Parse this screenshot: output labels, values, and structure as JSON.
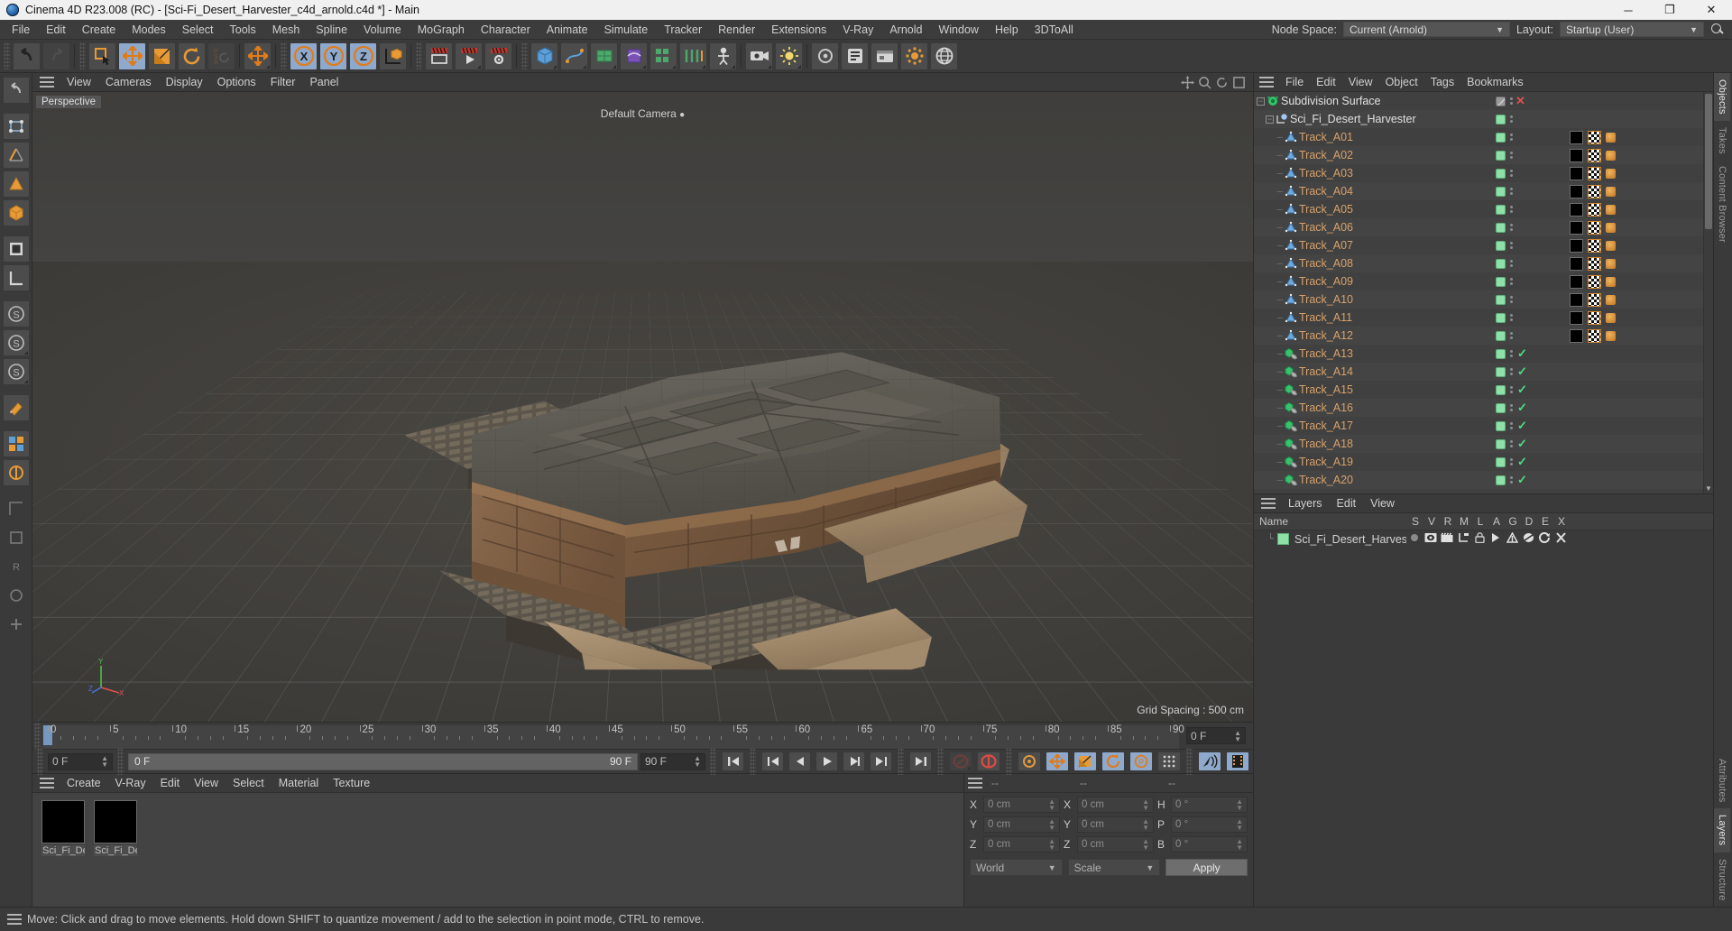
{
  "window": {
    "title": "Cinema 4D R23.008 (RC) - [Sci-Fi_Desert_Harvester_c4d_arnold.c4d *] - Main",
    "minimize": "─",
    "maximize": "❐",
    "close": "✕"
  },
  "menubar": {
    "items": [
      "File",
      "Edit",
      "Create",
      "Modes",
      "Select",
      "Tools",
      "Mesh",
      "Spline",
      "Volume",
      "MoGraph",
      "Character",
      "Animate",
      "Simulate",
      "Tracker",
      "Render",
      "Extensions",
      "V-Ray",
      "Arnold",
      "Window",
      "Help",
      "3DToAll"
    ],
    "node_space_label": "Node Space:",
    "node_space_value": "Current (Arnold)",
    "layout_label": "Layout:",
    "layout_value": "Startup (User)",
    "search_icon": "search-icon"
  },
  "viewport": {
    "menu": [
      "View",
      "Cameras",
      "Display",
      "Options",
      "Filter",
      "Panel"
    ],
    "view_label": "Perspective",
    "camera_label": "Default Camera",
    "grid_spacing": "Grid Spacing : 500 cm",
    "axis_x": "X",
    "axis_y": "Y",
    "axis_z": "Z"
  },
  "timeline": {
    "ticks": [
      0,
      5,
      10,
      15,
      20,
      25,
      30,
      35,
      40,
      45,
      50,
      55,
      60,
      65,
      70,
      75,
      80,
      85,
      90
    ],
    "current_frame": "0 F",
    "range_start": "0 F",
    "range_end": "90 F",
    "end_field": "90 F",
    "right_field": "0 F",
    "playhead_frame": 0
  },
  "material_manager": {
    "menu": [
      "Create",
      "V-Ray",
      "Edit",
      "View",
      "Select",
      "Material",
      "Texture"
    ],
    "materials": [
      {
        "name": "Sci_Fi_De",
        "color": "#000000"
      },
      {
        "name": "Sci_Fi_De",
        "color": "#000000"
      }
    ]
  },
  "coordinates": {
    "headers": [
      "--",
      "--",
      "--"
    ],
    "rows": [
      {
        "pos_label": "X",
        "pos_value": "0 cm",
        "size_label": "X",
        "size_value": "0 cm",
        "rot_label": "H",
        "rot_value": "0 °"
      },
      {
        "pos_label": "Y",
        "pos_value": "0 cm",
        "size_label": "Y",
        "size_value": "0 cm",
        "rot_label": "P",
        "rot_value": "0 °"
      },
      {
        "pos_label": "Z",
        "pos_value": "0 cm",
        "size_label": "Z",
        "size_value": "0 cm",
        "rot_label": "B",
        "rot_value": "0 °"
      }
    ],
    "coord_system": "World",
    "transform_mode": "Scale",
    "apply_label": "Apply"
  },
  "object_manager": {
    "menu": [
      "File",
      "Edit",
      "View",
      "Object",
      "Tags",
      "Bookmarks"
    ],
    "objects": [
      {
        "name": "Subdivision Surface",
        "icon": "subdivision-surface-icon",
        "depth": 0,
        "visible": true,
        "tags": [],
        "style": "top",
        "enabled_box": "disabled"
      },
      {
        "name": "Sci_Fi_Desert_Harvester",
        "icon": "null-object-icon",
        "depth": 1,
        "visible": true,
        "tags": [],
        "style": "top"
      },
      {
        "name": "Track_A01",
        "icon": "polygon-object-icon",
        "depth": 2,
        "tags": [
          "material",
          "uv",
          "phong"
        ]
      },
      {
        "name": "Track_A02",
        "icon": "polygon-object-icon",
        "depth": 2,
        "tags": [
          "material",
          "uv",
          "phong"
        ]
      },
      {
        "name": "Track_A03",
        "icon": "polygon-object-icon",
        "depth": 2,
        "tags": [
          "material",
          "uv",
          "phong"
        ]
      },
      {
        "name": "Track_A04",
        "icon": "polygon-object-icon",
        "depth": 2,
        "tags": [
          "material",
          "uv",
          "phong"
        ]
      },
      {
        "name": "Track_A05",
        "icon": "polygon-object-icon",
        "depth": 2,
        "tags": [
          "material",
          "uv",
          "phong"
        ]
      },
      {
        "name": "Track_A06",
        "icon": "polygon-object-icon",
        "depth": 2,
        "tags": [
          "material",
          "uv",
          "phong"
        ]
      },
      {
        "name": "Track_A07",
        "icon": "polygon-object-icon",
        "depth": 2,
        "tags": [
          "material",
          "uv",
          "phong"
        ]
      },
      {
        "name": "Track_A08",
        "icon": "polygon-object-icon",
        "depth": 2,
        "tags": [
          "material",
          "uv",
          "phong"
        ]
      },
      {
        "name": "Track_A09",
        "icon": "polygon-object-icon",
        "depth": 2,
        "tags": [
          "material",
          "uv",
          "phong"
        ]
      },
      {
        "name": "Track_A10",
        "icon": "polygon-object-icon",
        "depth": 2,
        "tags": [
          "material",
          "uv",
          "phong"
        ]
      },
      {
        "name": "Track_A11",
        "icon": "polygon-object-icon",
        "depth": 2,
        "tags": [
          "material",
          "uv",
          "phong"
        ]
      },
      {
        "name": "Track_A12",
        "icon": "polygon-object-icon",
        "depth": 2,
        "tags": [
          "material",
          "uv",
          "phong"
        ]
      },
      {
        "name": "Track_A13",
        "icon": "instance-object-icon",
        "depth": 2,
        "tags": [
          "check"
        ]
      },
      {
        "name": "Track_A14",
        "icon": "instance-object-icon",
        "depth": 2,
        "tags": [
          "check"
        ]
      },
      {
        "name": "Track_A15",
        "icon": "instance-object-icon",
        "depth": 2,
        "tags": [
          "check"
        ]
      },
      {
        "name": "Track_A16",
        "icon": "instance-object-icon",
        "depth": 2,
        "tags": [
          "check"
        ]
      },
      {
        "name": "Track_A17",
        "icon": "instance-object-icon",
        "depth": 2,
        "tags": [
          "check"
        ]
      },
      {
        "name": "Track_A18",
        "icon": "instance-object-icon",
        "depth": 2,
        "tags": [
          "check"
        ]
      },
      {
        "name": "Track_A19",
        "icon": "instance-object-icon",
        "depth": 2,
        "tags": [
          "check"
        ]
      },
      {
        "name": "Track_A20",
        "icon": "instance-object-icon",
        "depth": 2,
        "tags": [
          "check"
        ]
      }
    ]
  },
  "layers_panel": {
    "menu": [
      "Layers",
      "Edit",
      "View"
    ],
    "columns": [
      "Name",
      "S",
      "V",
      "R",
      "M",
      "L",
      "A",
      "G",
      "D",
      "E",
      "X"
    ],
    "rows": [
      {
        "name": "Sci_Fi_Desert_Harvester",
        "color": "#8fe0a8",
        "icons": [
          "solo-dot-icon",
          "eye-icon",
          "render-icon",
          "manager-icon",
          "lock-icon",
          "animation-icon",
          "generator-icon",
          "deformer-icon",
          "expression-icon",
          "xpresso-icon"
        ]
      }
    ]
  },
  "right_tabs": {
    "top": [
      "Objects",
      "Takes",
      "Content Browser"
    ],
    "bottom": [
      "Attributes",
      "Layers",
      "Structure"
    ],
    "top_active": "Objects",
    "bottom_active": "Layers"
  },
  "status_bar": {
    "message": "Move: Click and drag to move elements. Hold down SHIFT to quantize movement / add to the selection in point mode, CTRL to remove."
  }
}
